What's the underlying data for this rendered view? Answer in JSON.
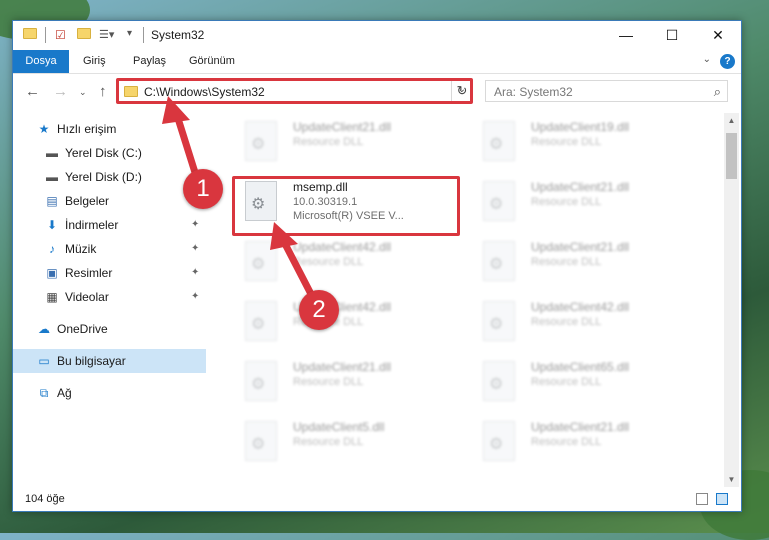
{
  "window": {
    "title": "System32",
    "minimize": "—",
    "maximize": "☐",
    "close": "✕"
  },
  "ribbon": {
    "tabs": [
      "Dosya",
      "Giriş",
      "Paylaş",
      "Görünüm"
    ],
    "help": "?"
  },
  "navigation": {
    "address": "C:\\Windows\\System32",
    "search_placeholder": "Ara: System32"
  },
  "sidebar": {
    "items": [
      {
        "label": "Hızlı erişim",
        "icon": "star-icon"
      },
      {
        "label": "Yerel Disk (C:)",
        "icon": "drive-icon"
      },
      {
        "label": "Yerel Disk (D:)",
        "icon": "drive-icon"
      },
      {
        "label": "Belgeler",
        "icon": "documents-icon"
      },
      {
        "label": "İndirmeler",
        "icon": "download-icon"
      },
      {
        "label": "Müzik",
        "icon": "music-icon"
      },
      {
        "label": "Resimler",
        "icon": "pictures-icon"
      },
      {
        "label": "Videolar",
        "icon": "video-icon"
      },
      {
        "label": "OneDrive",
        "icon": "cloud-icon"
      },
      {
        "label": "Bu bilgisayar",
        "icon": "computer-icon"
      },
      {
        "label": "Ağ",
        "icon": "network-icon"
      }
    ]
  },
  "files": {
    "highlighted": {
      "name": "msemp.dll",
      "version": "10.0.30319.1",
      "description": "Microsoft(R) VSEE V..."
    },
    "left_column": [
      {
        "name": "UpdateClient21.dll",
        "type": "Resource DLL"
      },
      {
        "name": "UpdateClient42.dll",
        "type": "Resource DLL"
      },
      {
        "name": "UpdateClient42.dll",
        "type": "Resource DLL"
      },
      {
        "name": "UpdateClient21.dll",
        "type": "Resource DLL"
      },
      {
        "name": "UpdateClient5.dll",
        "type": "Resource DLL"
      }
    ],
    "right_column": [
      {
        "name": "UpdateClient19.dll",
        "type": "Resource DLL"
      },
      {
        "name": "UpdateClient21.dll",
        "type": "Resource DLL"
      },
      {
        "name": "UpdateClient21.dll",
        "type": "Resource DLL"
      },
      {
        "name": "UpdateClient42.dll",
        "type": "Resource DLL"
      },
      {
        "name": "UpdateClient65.dll",
        "type": "Resource DLL"
      },
      {
        "name": "UpdateClient21.dll",
        "type": "Resource DLL"
      }
    ]
  },
  "status": {
    "count": "104 öğe"
  },
  "annotations": {
    "step1": "1",
    "step2": "2",
    "color": "#d9363e"
  }
}
